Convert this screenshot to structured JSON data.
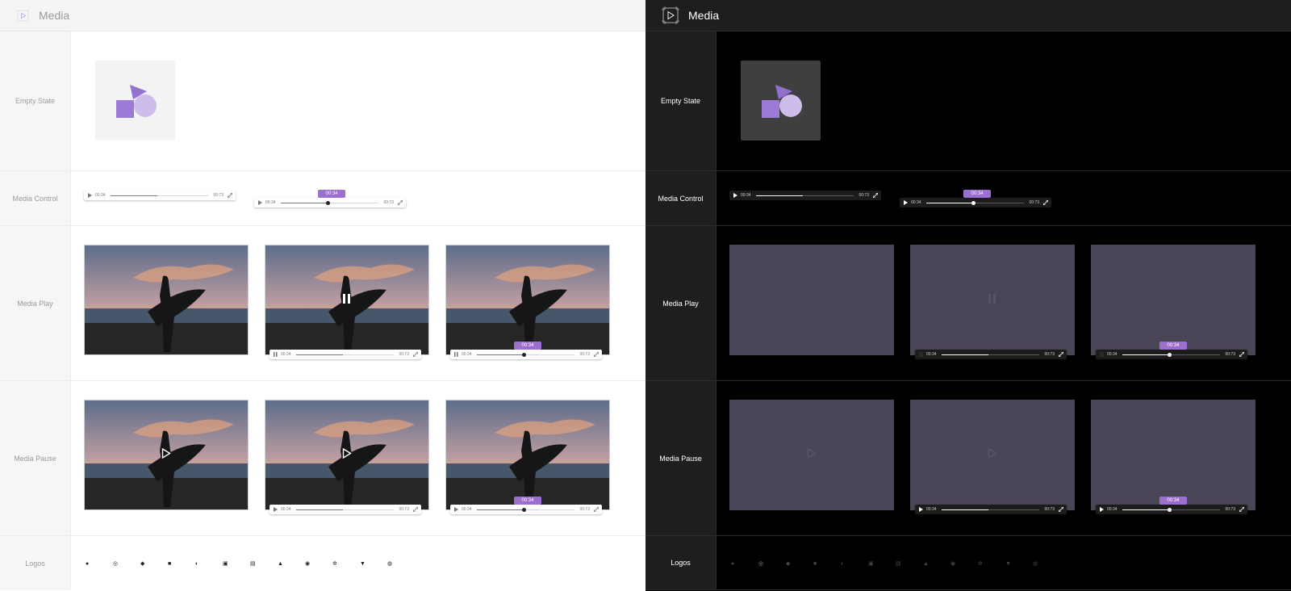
{
  "header": {
    "title": "Media"
  },
  "rows": {
    "empty_state": "Empty State",
    "media_control": "Media Control",
    "media_play": "Media Play",
    "media_pause": "Media Pause",
    "logos": "Logos"
  },
  "control": {
    "current_time": "00:34",
    "total_time": "00:73",
    "tooltip": "00:34",
    "progress": 0.48
  },
  "colors": {
    "accent": "#9b6fd0",
    "accent_light": "#d0c1ec",
    "dark_media_bg": "#4a4556"
  },
  "logos": [
    "apple-icon",
    "dribbble-icon",
    "dropbox-icon",
    "facebook-icon",
    "google-icon",
    "instagram-icon",
    "linkedin-icon",
    "paypal-icon",
    "pinterest-icon",
    "slack-icon",
    "twitter-icon",
    "whatsapp-icon"
  ]
}
